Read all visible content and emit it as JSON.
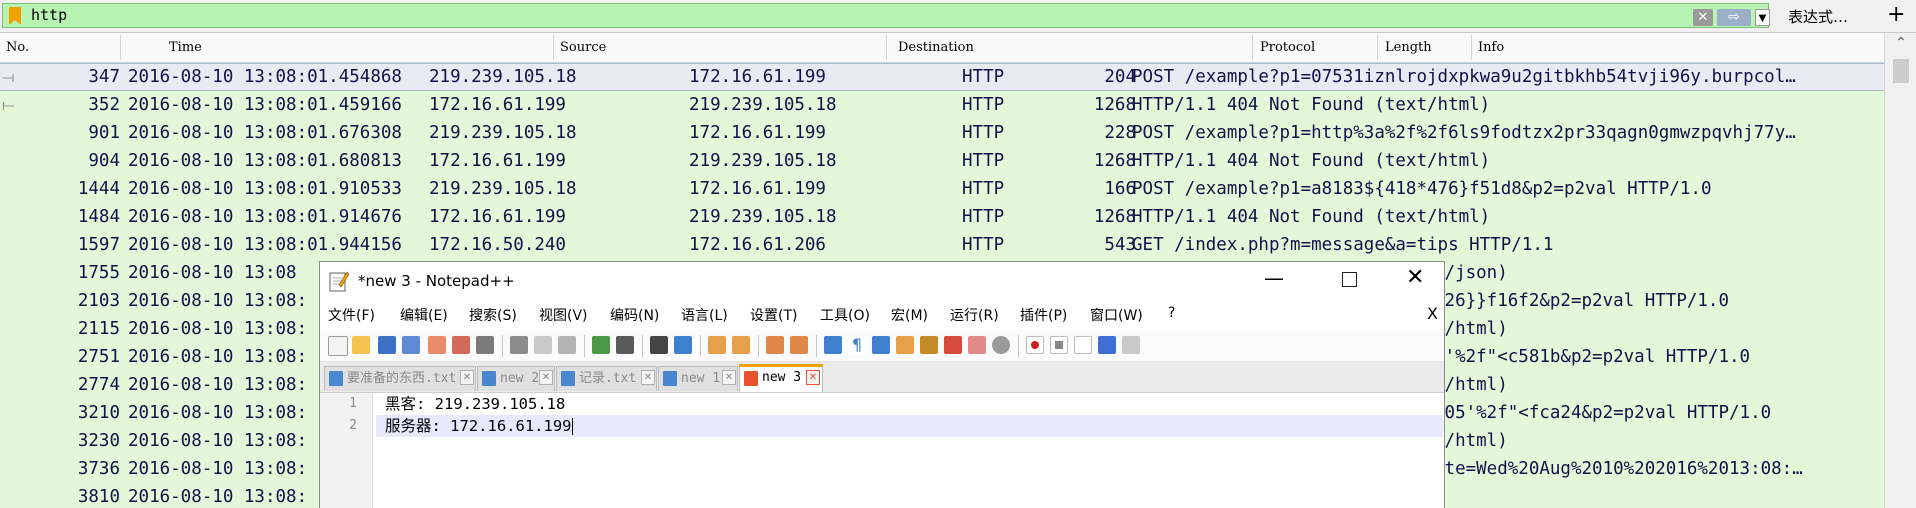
{
  "filter": {
    "value": "http",
    "expression_label": "表达式…",
    "plus_label": "+"
  },
  "columns": [
    "No.",
    "Time",
    "Source",
    "Destination",
    "Protocol",
    "Length",
    "Info"
  ],
  "packets": [
    {
      "no": "347",
      "time": "2016-08-10 13:08:01.454868",
      "source": "219.239.105.18",
      "destination": "172.16.61.199",
      "protocol": "HTTP",
      "length": "204",
      "info": "POST /example?p1=07531iznlrojdxpkwa9u2gitbkhb54tvji96y.burpcol…",
      "selected": true
    },
    {
      "no": "352",
      "time": "2016-08-10 13:08:01.459166",
      "source": "172.16.61.199",
      "destination": "219.239.105.18",
      "protocol": "HTTP",
      "length": "1268",
      "info": "HTTP/1.1 404 Not Found  (text/html)"
    },
    {
      "no": "901",
      "time": "2016-08-10 13:08:01.676308",
      "source": "219.239.105.18",
      "destination": "172.16.61.199",
      "protocol": "HTTP",
      "length": "228",
      "info": "POST /example?p1=http%3a%2f%2f6ls9fodtzx2pr33qagn0gmwzpqvhj77y…"
    },
    {
      "no": "904",
      "time": "2016-08-10 13:08:01.680813",
      "source": "172.16.61.199",
      "destination": "219.239.105.18",
      "protocol": "HTTP",
      "length": "1268",
      "info": "HTTP/1.1 404 Not Found  (text/html)"
    },
    {
      "no": "1444",
      "time": "2016-08-10 13:08:01.910533",
      "source": "219.239.105.18",
      "destination": "172.16.61.199",
      "protocol": "HTTP",
      "length": "166",
      "info": "POST /example?p1=a8183${418*476}f51d8&p2=p2val HTTP/1.0"
    },
    {
      "no": "1484",
      "time": "2016-08-10 13:08:01.914676",
      "source": "172.16.61.199",
      "destination": "219.239.105.18",
      "protocol": "HTTP",
      "length": "1268",
      "info": "HTTP/1.1 404 Not Found  (text/html)"
    },
    {
      "no": "1597",
      "time": "2016-08-10 13:08:01.944156",
      "source": "172.16.50.240",
      "destination": "172.16.61.206",
      "protocol": "HTTP",
      "length": "543",
      "info": "GET /index.php?m=message&a=tips HTTP/1.1"
    },
    {
      "no": "1755",
      "time": "2016-08-10 13:08",
      "source": "",
      "destination": "",
      "protocol": "",
      "length": "",
      "info": "n/json)"
    },
    {
      "no": "2103",
      "time": "2016-08-10 13:08:",
      "source": "",
      "destination": "",
      "protocol": "",
      "length": "",
      "info": "826}}f16f2&p2=p2val HTTP/1.0"
    },
    {
      "no": "2115",
      "time": "2016-08-10 13:08:",
      "source": "",
      "destination": "",
      "protocol": "",
      "length": "",
      "info": "t/html)"
    },
    {
      "no": "2751",
      "time": "2016-08-10 13:08:",
      "source": "",
      "destination": "",
      "protocol": "",
      "length": "",
      "info": "1'%2f\"<c581b&p2=p2val HTTP/1.0"
    },
    {
      "no": "2774",
      "time": "2016-08-10 13:08:",
      "source": "",
      "destination": "",
      "protocol": "",
      "length": "",
      "info": "t/html)"
    },
    {
      "no": "3210",
      "time": "2016-08-10 13:08:",
      "source": "",
      "destination": "",
      "protocol": "",
      "length": "",
      "info": "605'%2f\"<fca24&p2=p2val HTTP/1.0"
    },
    {
      "no": "3230",
      "time": "2016-08-10 13:08:",
      "source": "",
      "destination": "",
      "protocol": "",
      "length": "",
      "info": "t/html)"
    },
    {
      "no": "3736",
      "time": "2016-08-10 13:08:",
      "source": "",
      "destination": "",
      "protocol": "",
      "length": "",
      "info": "ate=Wed%20Aug%2010%202016%2013:08:…"
    },
    {
      "no": "3810",
      "time": "2016-08-10 13:08:",
      "source": "",
      "destination": "",
      "protocol": "",
      "length": "",
      "info": ""
    }
  ],
  "notepad": {
    "title": "*new 3 - Notepad++",
    "menu": [
      "文件(F)",
      "编辑(E)",
      "搜索(S)",
      "视图(V)",
      "编码(N)",
      "语言(L)",
      "设置(T)",
      "工具(O)",
      "宏(M)",
      "运行(R)",
      "插件(P)",
      "窗口(W)",
      "?"
    ],
    "menu_close": "X",
    "tabs": [
      {
        "label": "要准备的东西.txt",
        "active": false
      },
      {
        "label": "new 2",
        "active": false
      },
      {
        "label": "记录.txt",
        "active": false
      },
      {
        "label": "new 1",
        "active": false
      },
      {
        "label": "new 3",
        "active": true
      }
    ],
    "lines": [
      {
        "num": "1",
        "text": "黑客: 219.239.105.18"
      },
      {
        "num": "2",
        "text": "服务器: 172.16.61.199"
      }
    ]
  },
  "colors": {
    "filter_valid_bg": "#b7f3b2",
    "packet_row_bg": "#e3f8d8",
    "selected_row_bg": "#e6ecf1",
    "active_tab_accent": "#f0a000"
  }
}
